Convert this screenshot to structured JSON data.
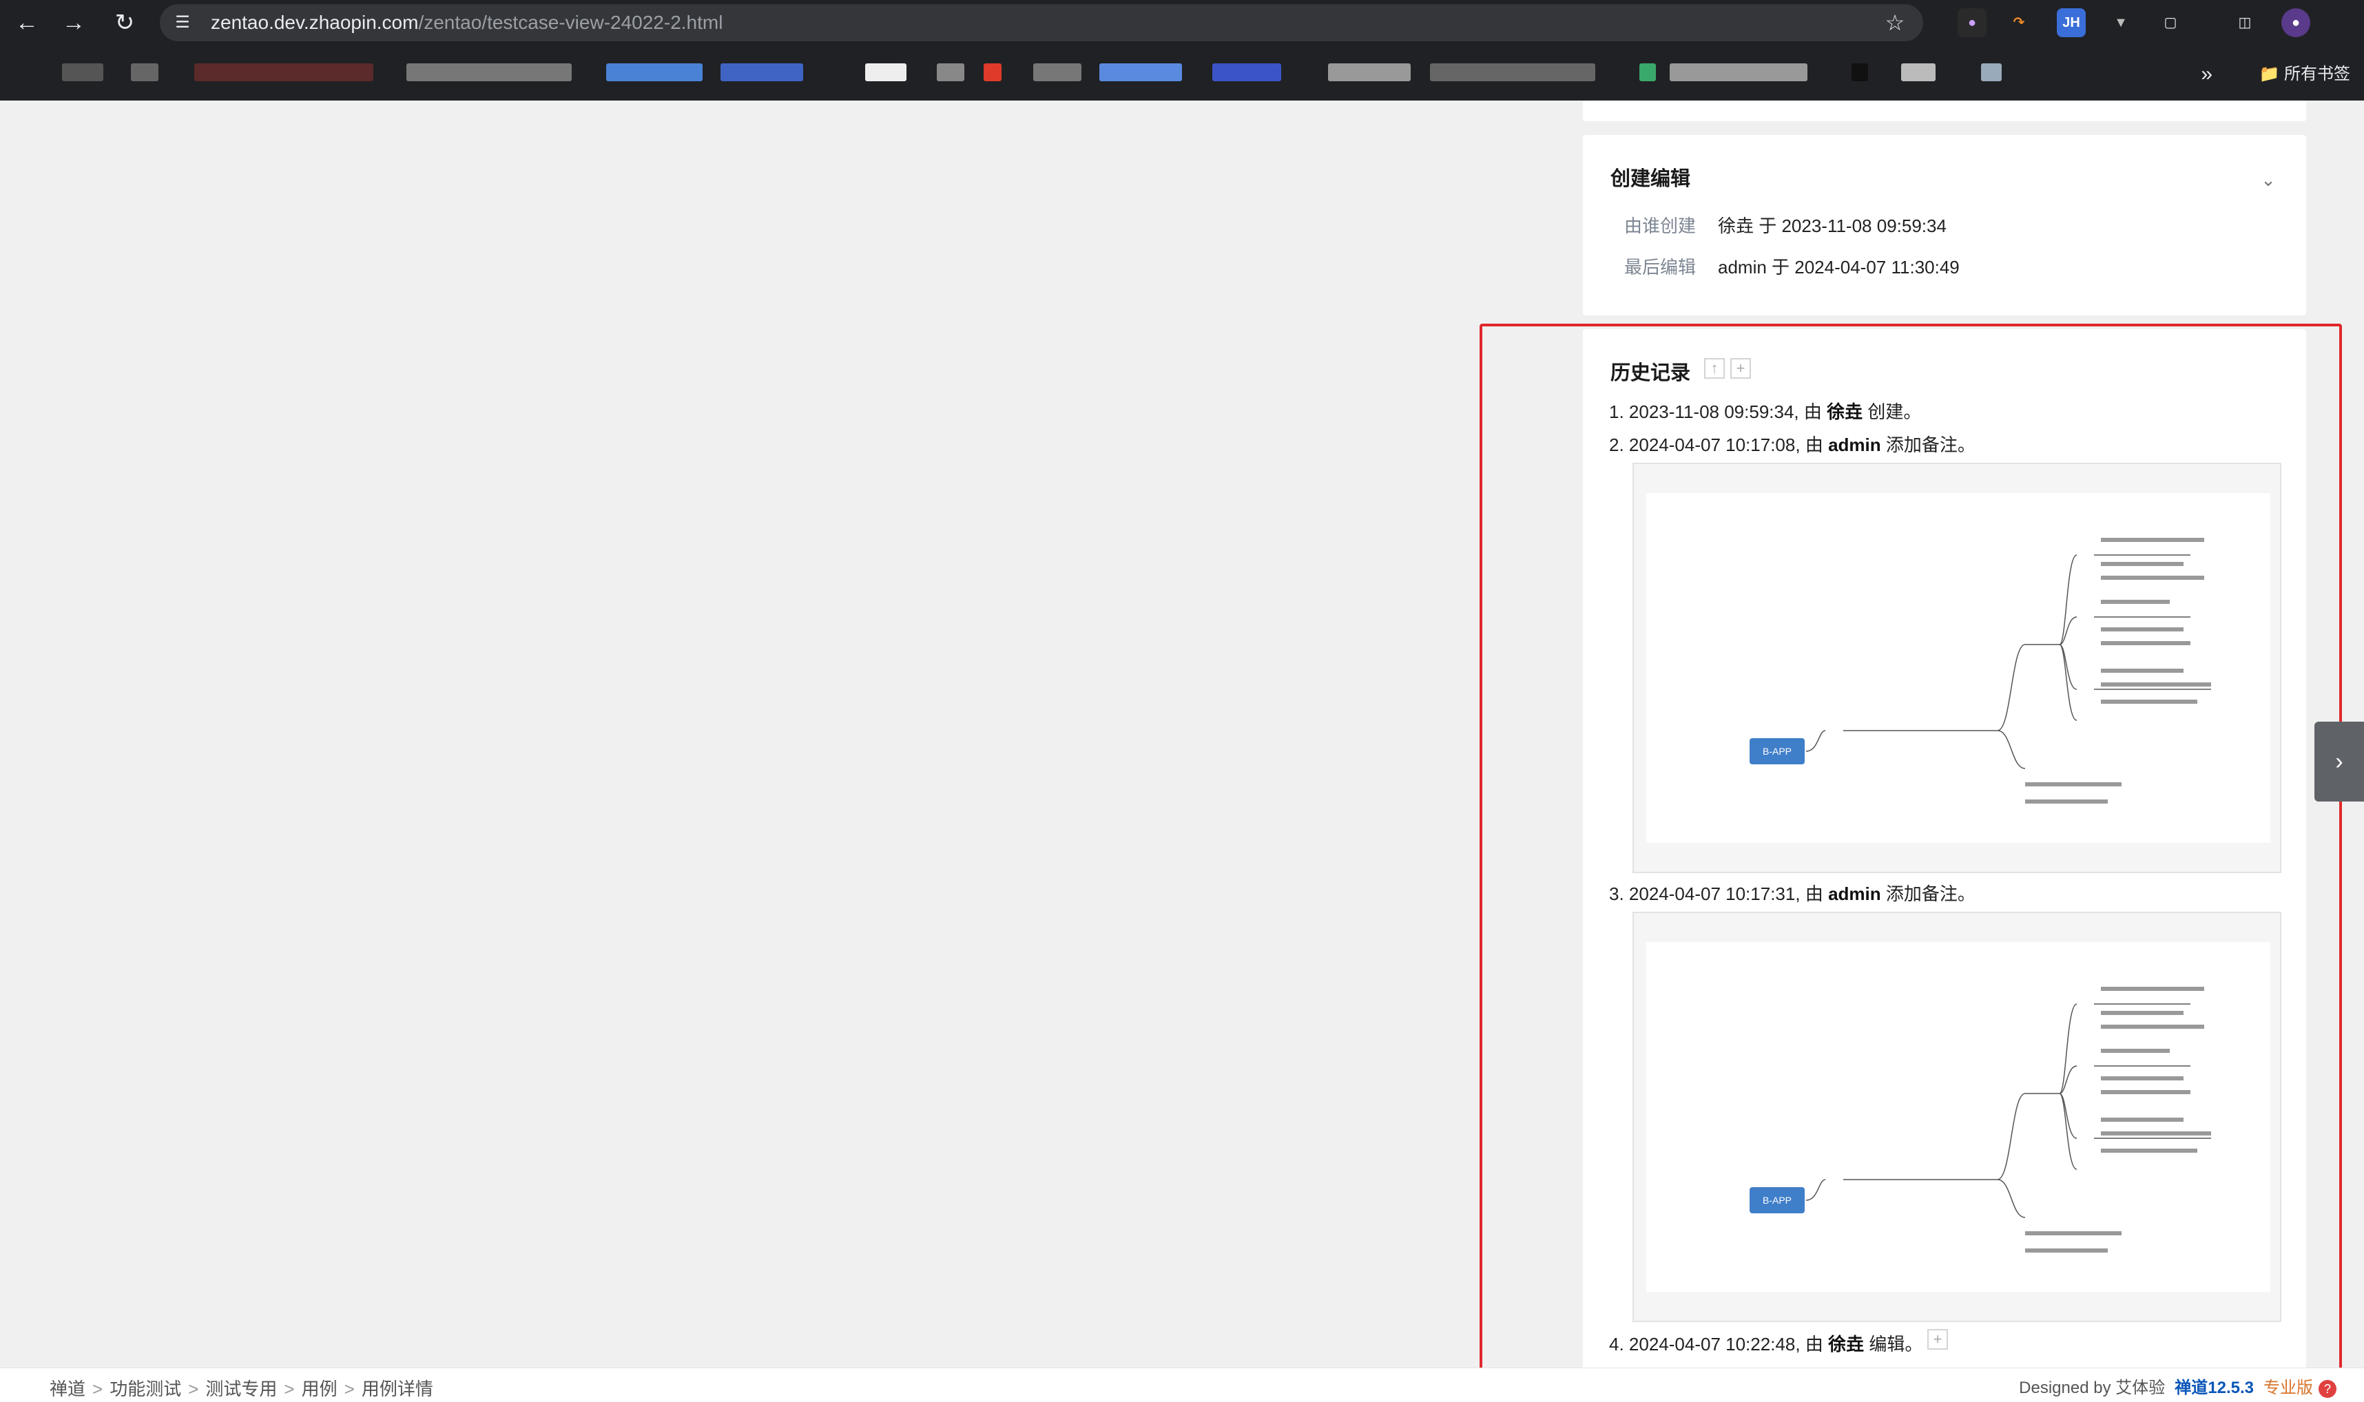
{
  "browser": {
    "url_host": "zentao.dev.zhaopin.com",
    "url_path": "/zentao/testcase-view-24022-2.html",
    "bookmarks_label": "所有书签",
    "extension_badge": "JH",
    "icons": [
      "back-icon",
      "forward-icon",
      "reload-icon",
      "site-info-icon",
      "star-icon",
      "extensions-icon",
      "sidepanel-icon",
      "profile-avatar-icon",
      "folder-icon"
    ]
  },
  "create_edit": {
    "title": "创建编辑",
    "rows": [
      {
        "label": "由谁创建",
        "value": "徐垚 于 2023-11-08 09:59:34"
      },
      {
        "label": "最后编辑",
        "value": "admin 于 2024-04-07 11:30:49"
      }
    ]
  },
  "history": {
    "title": "历史记录",
    "entries": [
      {
        "num": "1.",
        "time": "2023-11-08 09:59:34,",
        "pre": "由",
        "user": "徐垚",
        "action": "创建。"
      },
      {
        "num": "2.",
        "time": "2024-04-07 10:17:08,",
        "pre": "由",
        "user": "admin",
        "action": "添加备注。"
      },
      {
        "num": "3.",
        "time": "2024-04-07 10:17:31,",
        "pre": "由",
        "user": "admin",
        "action": "添加备注。"
      },
      {
        "num": "4.",
        "time": "2024-04-07 10:22:48,",
        "pre": "由",
        "user": "徐垚",
        "action": "编辑。"
      }
    ],
    "thumbnail_node_label": "B-APP"
  },
  "footer": {
    "breadcrumb": [
      "禅道",
      "功能测试",
      "测试专用",
      "用例",
      "用例详情"
    ],
    "designed_by": "Designed by 艾体验",
    "version": "禅道12.5.3",
    "edition": "专业版"
  },
  "colors": {
    "highlight": "#e0282c",
    "brand": "#0a56b8",
    "node": "#3f7ec8"
  }
}
